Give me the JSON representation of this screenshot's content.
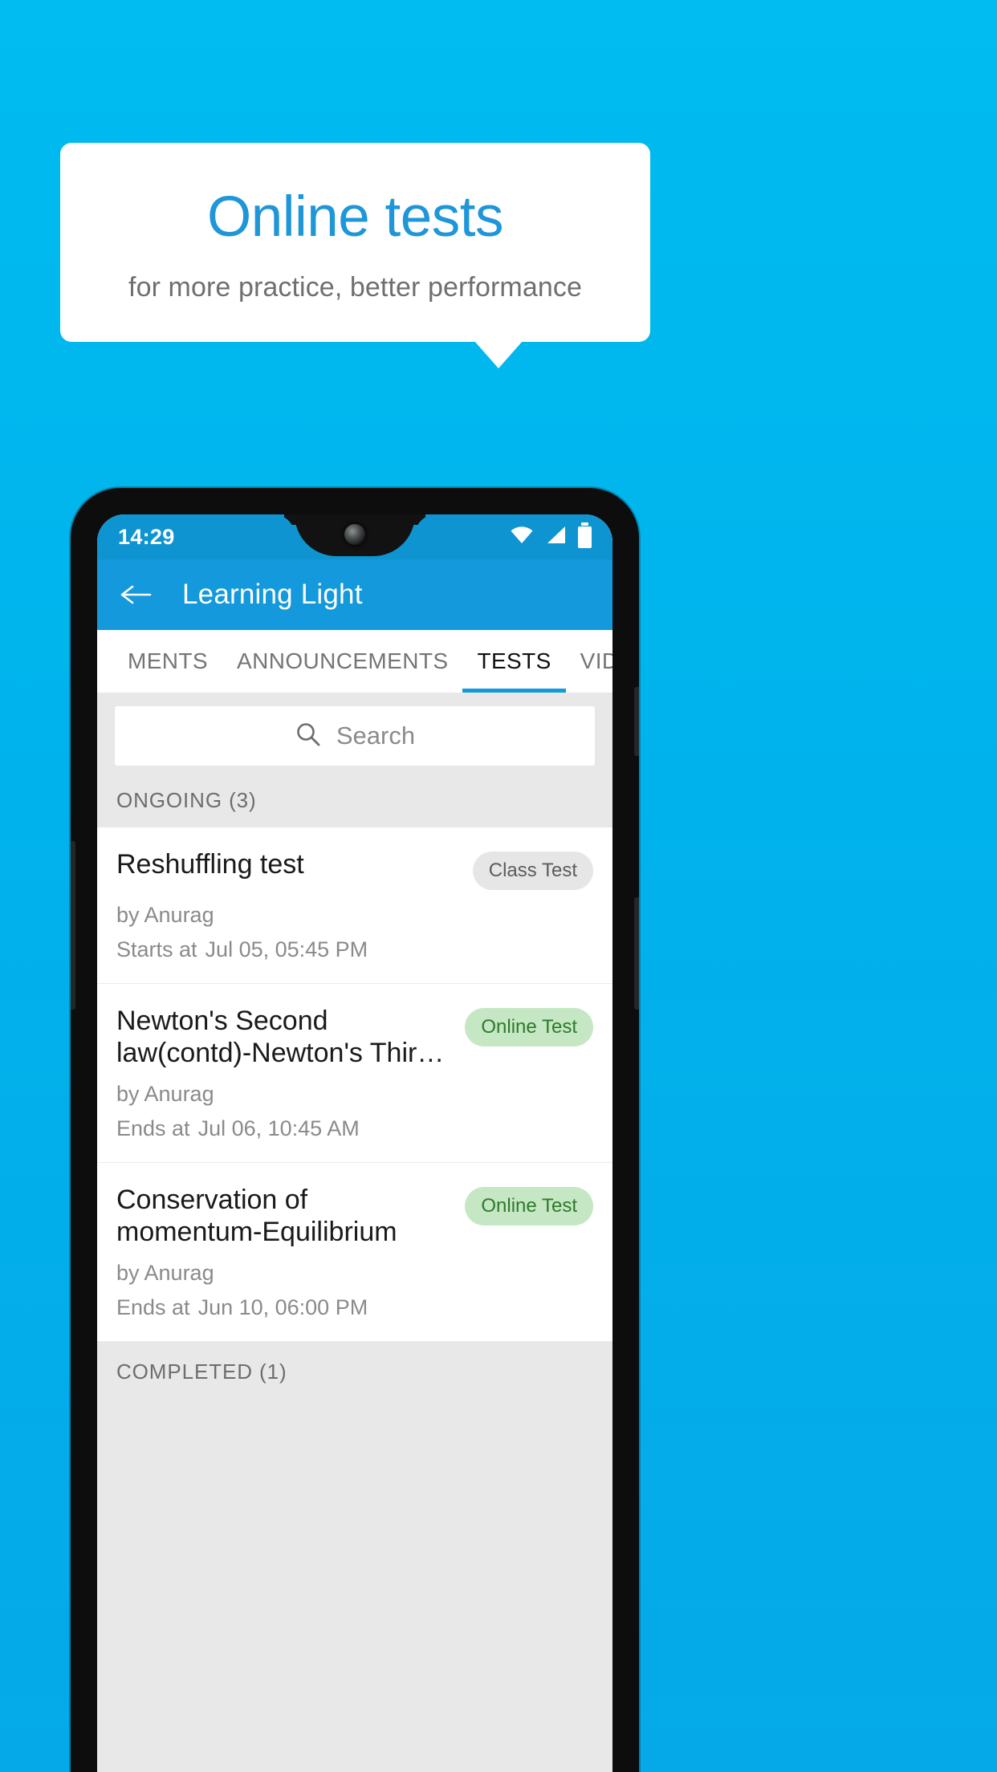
{
  "promo": {
    "title": "Online tests",
    "subtitle": "for more practice, better performance"
  },
  "phone": {
    "statusbar": {
      "time": "14:29",
      "icons": [
        "wifi-icon",
        "signal-icon",
        "battery-icon"
      ]
    },
    "appbar": {
      "back_icon": "back-arrow-icon",
      "title": "Learning Light"
    },
    "tabs": [
      {
        "label": "MENTS",
        "active": false
      },
      {
        "label": "ANNOUNCEMENTS",
        "active": false
      },
      {
        "label": "TESTS",
        "active": true
      },
      {
        "label": "VIDEOS",
        "active": false
      }
    ],
    "search": {
      "icon": "search-icon",
      "placeholder": "Search",
      "value": ""
    },
    "sections": [
      {
        "header": "ONGOING (3)"
      },
      {
        "header": "COMPLETED (1)"
      }
    ],
    "tests": [
      {
        "title": "Reshuffling test",
        "badge": "Class Test",
        "badge_type": "class-test",
        "author": "by Anurag",
        "time_label": "Starts at",
        "time_value": "Jul 05, 05:45 PM"
      },
      {
        "title": "Newton's Second law(contd)-Newton's Thir…",
        "badge": "Online Test",
        "badge_type": "online-test",
        "author": "by Anurag",
        "time_label": "Ends at",
        "time_value": "Jul 06, 10:45 AM"
      },
      {
        "title": "Conservation of momentum-Equilibrium",
        "badge": "Online Test",
        "badge_type": "online-test",
        "author": "by Anurag",
        "time_label": "Ends at",
        "time_value": "Jun 10, 06:00 PM"
      }
    ],
    "colors": {
      "brand_blue": "#1399dc",
      "status_blue": "#0f94d2",
      "background_blue": "#00b3ec",
      "online_badge_bg": "#c5e7c3",
      "online_badge_text": "#2e7a2c",
      "class_badge_bg": "#e6e6e6",
      "class_badge_text": "#5c5c5c"
    }
  }
}
